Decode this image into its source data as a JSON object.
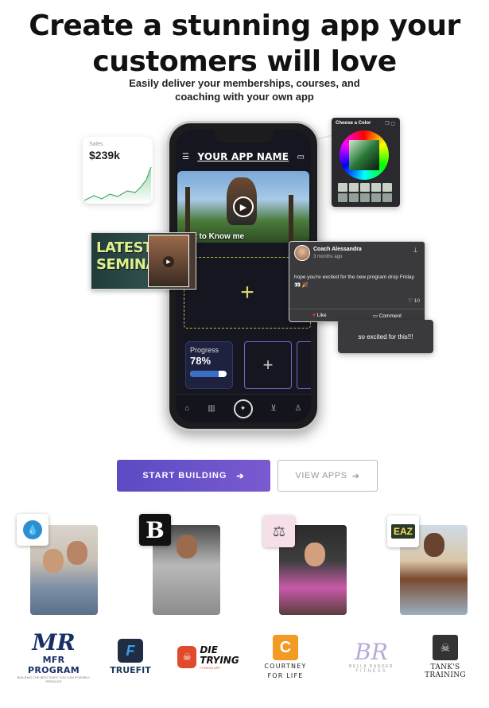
{
  "hero": {
    "headline_line1": "Create a stunning app your",
    "headline_line2": "customers will love",
    "subtitle_line1": "Easily deliver your memberships, courses, and",
    "subtitle_line2": "coaching with your own app"
  },
  "phone": {
    "app_name": "YOUR APP NAME",
    "video_caption": "Get to Know me",
    "progress_label": "Progress",
    "progress_value": "78%",
    "progress_fraction": 0.78
  },
  "sales_card": {
    "label": "Sales",
    "value": "$239k"
  },
  "color_picker": {
    "title": "Choose a Color"
  },
  "seminars_card": {
    "line1": "LATEST",
    "line2": "SEMINARS"
  },
  "coach_post": {
    "name": "Coach Alessandra",
    "time": "3 months ago",
    "message": "hope you're excited for the new program drop Friday 👀 🎉",
    "like_count": "10",
    "like_label": "Like",
    "comment_label": "Comment"
  },
  "reply_bubble": {
    "text": "so excited for this!!!"
  },
  "buttons": {
    "start_building": "START BUILDING",
    "view_apps": "VIEW APPS"
  },
  "client_badges": {
    "b2_letter": "B",
    "b4_text": "EAZ"
  },
  "logos": {
    "mfr_mark": "MR",
    "mfr_name": "MFR PROGRAM",
    "mfr_tagline": "BUILDING THE BEST BODY YOU CAN POSSIBLY PRODUCE",
    "truefit_name": "TRUEFIT",
    "die_name_1": "DIE",
    "die_name_2": "TRYING",
    "die_tagline": "FITNESS APP",
    "courtney_mark": "C",
    "courtney_name_1": "COURTNEY",
    "courtney_name_2": "FOR LIFE",
    "bella_mark": "BR",
    "bella_name": "BELLA RANDER",
    "bella_tagline": "FITNESS",
    "tanks_name": "TANK'S TRAINING"
  },
  "colors": {
    "primary_gradient_start": "#5b4bc4",
    "primary_gradient_end": "#7a5ad0",
    "accent_yellow": "#d8d86a",
    "like_red": "#e33333"
  }
}
